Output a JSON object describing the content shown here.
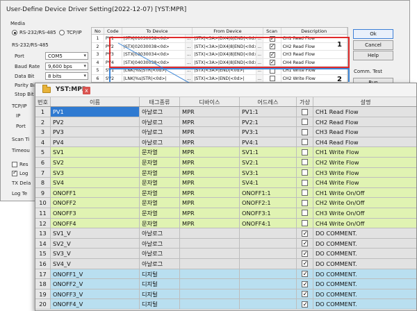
{
  "dialog": {
    "title": "User-Define Device Driver Setting(2022-12-07) [YST:MPR]",
    "media_label": "Media",
    "media_options": [
      {
        "label": "RS-232/RS-485",
        "selected": true
      },
      {
        "label": "TCP/IP",
        "selected": false
      }
    ],
    "serial_group_label": "RS-232/RS-485",
    "serial_fields": [
      {
        "label": "Port",
        "value": "COM5"
      },
      {
        "label": "Baud Rate",
        "value": "9,600 bps"
      },
      {
        "label": "Data Bit",
        "value": "8 bits"
      },
      {
        "label": "Parity Bit",
        "value": ""
      },
      {
        "label": "Stop Bit",
        "value": ""
      }
    ],
    "tcp_group_label": "TCP/IP",
    "tcp_fields": [
      {
        "label": "IP"
      },
      {
        "label": "Port"
      }
    ],
    "scan_label": "Scan Ti",
    "timeout_label": "Timeou",
    "res_label": "Res",
    "log_label": "Log",
    "tx_delay_label": "TX Dela",
    "log_text_label": "Log Te",
    "buttons": {
      "ok": "Ok",
      "cancel": "Cancel",
      "help": "Help",
      "comm_test": "Comm. Test",
      "run": "Run"
    },
    "table": {
      "headers": [
        "No",
        "Code",
        "To Device",
        "From Device",
        "Scan",
        "Description"
      ],
      "dots": "...",
      "rows": [
        {
          "no": "1",
          "code": "PV1",
          "to": "|STX|01030038<0d>",
          "from": "|STX|<3A>|DX4|8|END|<0d>|",
          "scan": true,
          "desc": "CH1 Read Flow"
        },
        {
          "no": "2",
          "code": "PV2",
          "to": "|STX|02030038<0d>",
          "from": "|STX|<3A>|DX4|8|END|<0d>|",
          "scan": true,
          "desc": "CH2 Read Flow"
        },
        {
          "no": "3",
          "code": "PV3",
          "to": "|STX|03030034<0d>",
          "from": "|STX|<3A>|DX4|8|END|<0d>|",
          "scan": true,
          "desc": "CH3 Read Flow"
        },
        {
          "no": "4",
          "code": "PV4",
          "to": "|STX|04030038<0d>",
          "from": "|STX|<3A>|DX4|8|END|<0d>|",
          "scan": true,
          "desc": "CH4 Read Flow"
        },
        {
          "no": "5",
          "code": "SV1",
          "to": "|LNK|%s|STR|<0d>|",
          "from": "|STX|<3A>|END|<0d>|",
          "scan": false,
          "desc": "CH1 Write Flow"
        },
        {
          "no": "6",
          "code": "SV2",
          "to": "|LNK|%s|STR|<0d>|",
          "from": "|STX|<3A>|END|<0d>|",
          "scan": false,
          "desc": "CH2 Write Flow"
        }
      ]
    },
    "annotations": [
      "1",
      "2"
    ]
  },
  "window": {
    "title": "YST:MPR",
    "close_label": "x",
    "headers": [
      "번호",
      "이름",
      "태그종류",
      "디바이스",
      "어드레스",
      "가상",
      "설명"
    ],
    "rows": [
      {
        "no": "1",
        "name": "PV1",
        "type": "아날로그",
        "device": "MPR",
        "address": "PV1:1",
        "virtual": false,
        "desc": "CH1 Read Flow",
        "group": "gray"
      },
      {
        "no": "2",
        "name": "PV2",
        "type": "아날로그",
        "device": "MPR",
        "address": "PV2:1",
        "virtual": false,
        "desc": "CH2 Read Flow",
        "group": "gray"
      },
      {
        "no": "3",
        "name": "PV3",
        "type": "아날로그",
        "device": "MPR",
        "address": "PV3:1",
        "virtual": false,
        "desc": "CH3 Read Flow",
        "group": "gray"
      },
      {
        "no": "4",
        "name": "PV4",
        "type": "아날로그",
        "device": "MPR",
        "address": "PV4:1",
        "virtual": false,
        "desc": "CH4 Read Flow",
        "group": "gray"
      },
      {
        "no": "5",
        "name": "SV1",
        "type": "문자열",
        "device": "MPR",
        "address": "SV1:1",
        "virtual": false,
        "desc": "CH1 Write Flow",
        "group": "green"
      },
      {
        "no": "6",
        "name": "SV2",
        "type": "문자열",
        "device": "MPR",
        "address": "SV2:1",
        "virtual": false,
        "desc": "CH2 Write Flow",
        "group": "green"
      },
      {
        "no": "7",
        "name": "SV3",
        "type": "문자열",
        "device": "MPR",
        "address": "SV3:1",
        "virtual": false,
        "desc": "CH3 Write Flow",
        "group": "green"
      },
      {
        "no": "8",
        "name": "SV4",
        "type": "문자열",
        "device": "MPR",
        "address": "SV4:1",
        "virtual": false,
        "desc": "CH4 Write Flow",
        "group": "green"
      },
      {
        "no": "9",
        "name": "ONOFF1",
        "type": "문자열",
        "device": "MPR",
        "address": "ONOFF1:1",
        "virtual": false,
        "desc": "CH1 Write On/Off",
        "group": "green"
      },
      {
        "no": "10",
        "name": "ONOFF2",
        "type": "문자열",
        "device": "MPR",
        "address": "ONOFF2:1",
        "virtual": false,
        "desc": "CH2 Write On/Off",
        "group": "green"
      },
      {
        "no": "11",
        "name": "ONOFF3",
        "type": "문자열",
        "device": "MPR",
        "address": "ONOFF3:1",
        "virtual": false,
        "desc": "CH3 Write On/Off",
        "group": "green"
      },
      {
        "no": "12",
        "name": "ONOFF4",
        "type": "문자열",
        "device": "MPR",
        "address": "ONOFF4:1",
        "virtual": false,
        "desc": "CH4 Write On/Off",
        "group": "green"
      },
      {
        "no": "13",
        "name": "SV1_V",
        "type": "아날로그",
        "device": "",
        "address": "",
        "virtual": true,
        "desc": "DO COMMENT.",
        "group": "gray"
      },
      {
        "no": "14",
        "name": "SV2_V",
        "type": "아날로그",
        "device": "",
        "address": "",
        "virtual": true,
        "desc": "DO COMMENT.",
        "group": "gray"
      },
      {
        "no": "15",
        "name": "SV3_V",
        "type": "아날로그",
        "device": "",
        "address": "",
        "virtual": true,
        "desc": "DO COMMENT.",
        "group": "gray"
      },
      {
        "no": "16",
        "name": "SV4_V",
        "type": "아날로그",
        "device": "",
        "address": "",
        "virtual": true,
        "desc": "DO COMMENT.",
        "group": "gray"
      },
      {
        "no": "17",
        "name": "ONOFF1_V",
        "type": "디지털",
        "device": "",
        "address": "",
        "virtual": true,
        "desc": "DO COMMENT.",
        "group": "blue"
      },
      {
        "no": "18",
        "name": "ONOFF2_V",
        "type": "디지털",
        "device": "",
        "address": "",
        "virtual": true,
        "desc": "DO COMMENT.",
        "group": "blue"
      },
      {
        "no": "19",
        "name": "ONOFF3_V",
        "type": "디지털",
        "device": "",
        "address": "",
        "virtual": true,
        "desc": "DO COMMENT.",
        "group": "blue"
      },
      {
        "no": "20",
        "name": "ONOFF4_V",
        "type": "디지털",
        "device": "",
        "address": "",
        "virtual": true,
        "desc": "DO COMMENT.",
        "group": "blue"
      }
    ]
  },
  "colors": {
    "highlight_red": "#e02a2a",
    "highlight_blue": "#3b86d8",
    "row_gray": "#e2e2e2",
    "row_green": "#e0f3b2",
    "row_blue": "#b9dff0",
    "selection": "#2f7ad1"
  }
}
